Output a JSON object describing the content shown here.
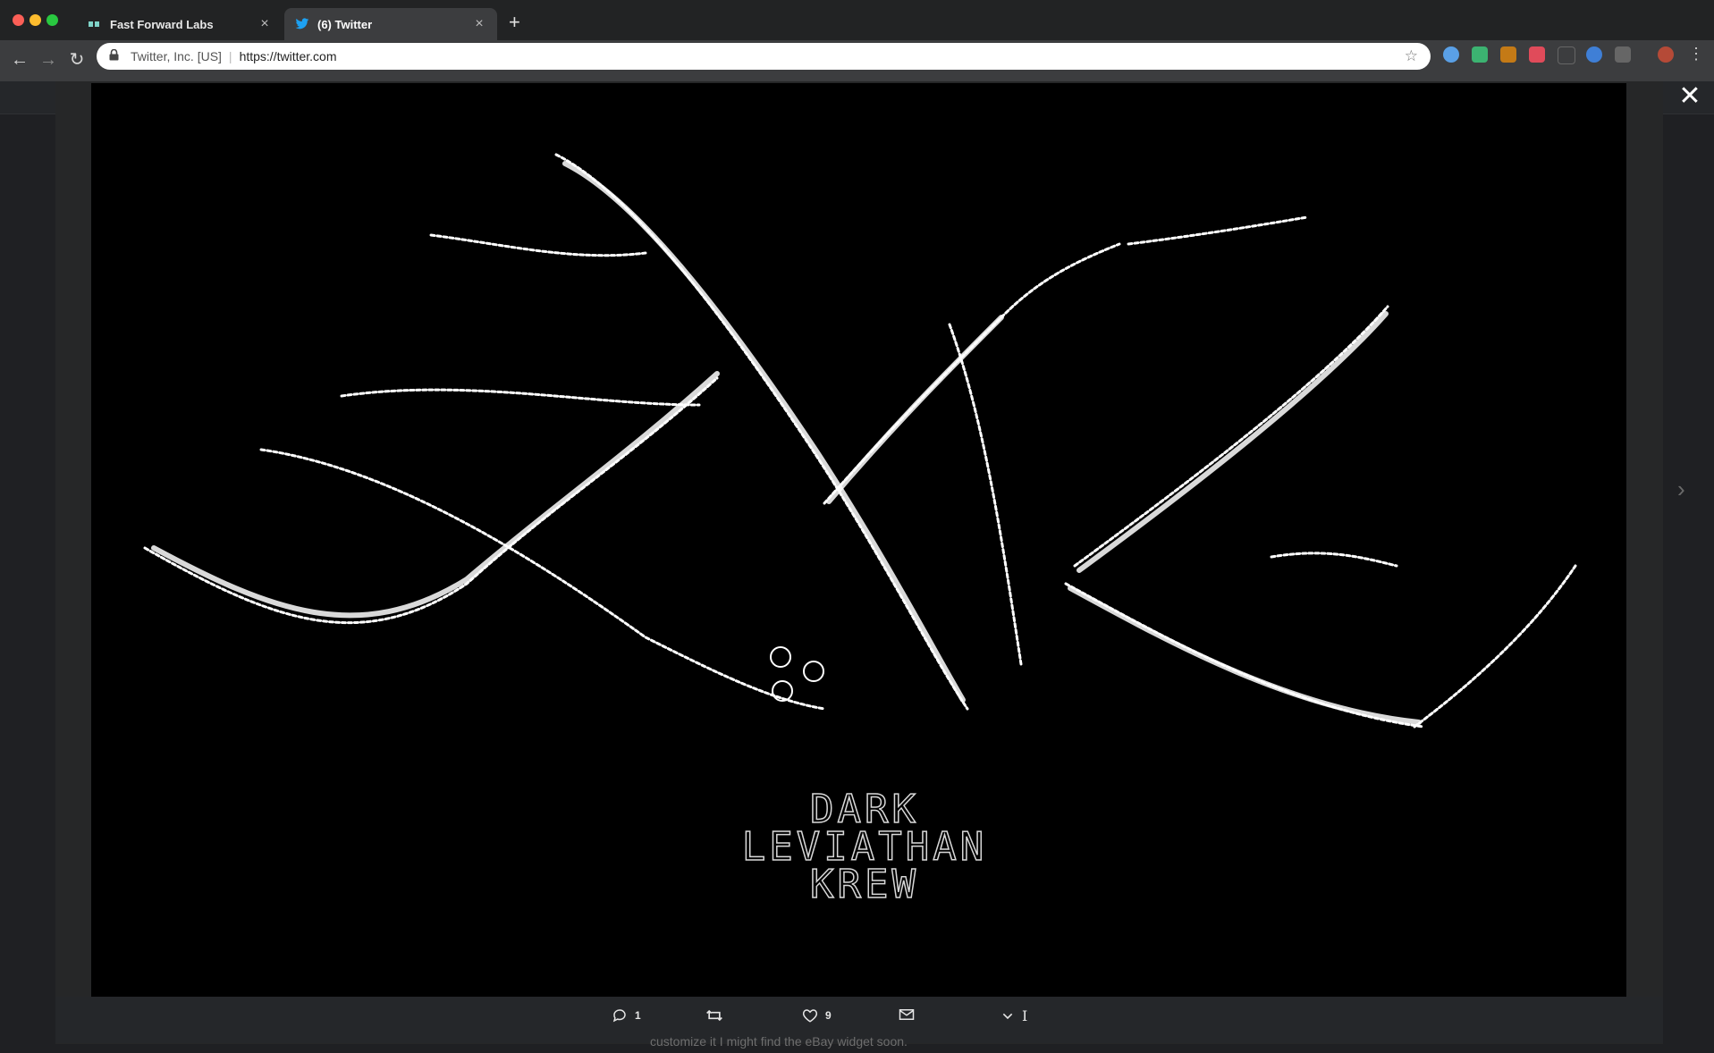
{
  "browser": {
    "tabs": [
      {
        "title": "Fast Forward Labs",
        "active": false,
        "favicon": "ff-logo-icon"
      },
      {
        "title": "(6) Twitter",
        "active": true,
        "favicon": "twitter-bird-icon"
      }
    ],
    "address_bar": {
      "site_identity": "Twitter, Inc. [US]",
      "url": "https://twitter.com"
    }
  },
  "media_viewer": {
    "artwork_text": [
      "DARK",
      "LEVIATHAN",
      "KREW"
    ],
    "actions": {
      "reply_count": "1",
      "retweet_count": "",
      "like_count": "9"
    }
  },
  "background_tweet": {
    "text": "customize it I might find the eBay widget soon."
  },
  "colors": {
    "accent": "#1da1f2",
    "media_bg": "#000000",
    "chrome_dark": "#222324",
    "toolbar": "#3c3d3f"
  }
}
